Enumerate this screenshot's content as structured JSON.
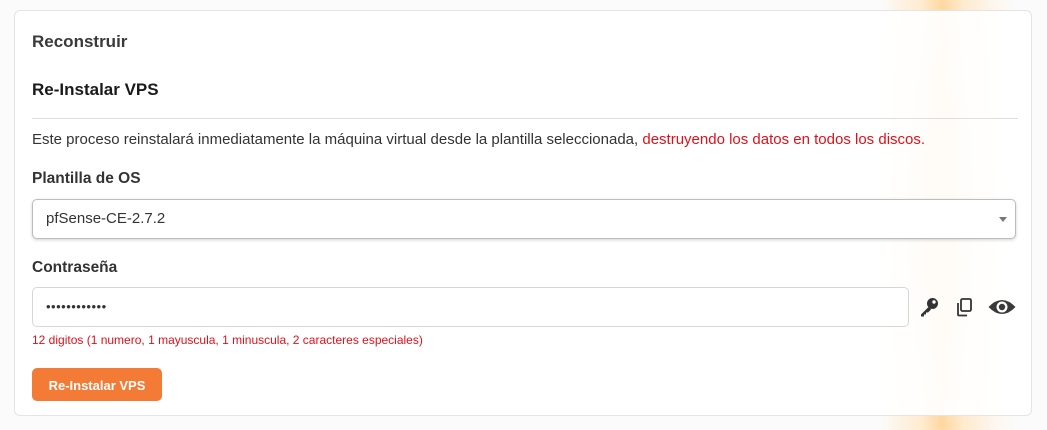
{
  "card": {
    "title": "Reconstruir"
  },
  "section": {
    "title": "Re-Instalar VPS",
    "description": "Este proceso reinstalará inmediatamente la máquina virtual desde la plantilla seleccionada, ",
    "warning": "destruyendo los datos en todos los discos."
  },
  "os_template": {
    "label": "Plantilla de OS",
    "selected": "pfSense-CE-2.7.2"
  },
  "password": {
    "label": "Contraseña",
    "value": "••••••••••••",
    "hint": "12 digitos (1 numero, 1 mayuscula, 1 minuscula, 2 caracteres especiales)",
    "icons": [
      "key-icon",
      "copy-icon",
      "eye-icon"
    ]
  },
  "submit": {
    "label": "Re-Instalar VPS"
  },
  "colors": {
    "accent": "#f37b36",
    "warning": "#e0101a"
  }
}
